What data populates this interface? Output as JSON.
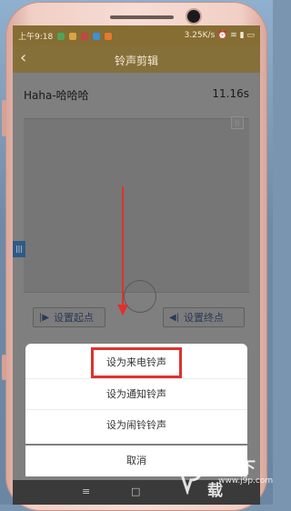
{
  "status_bar": {
    "time": "上午9:18",
    "network_speed": "3.25K/s",
    "icons": [
      "wechat-icon",
      "app-icon",
      "app-icon",
      "app-icon",
      "app-icon",
      "app-icon",
      "app-icon",
      "alarm-icon",
      "wifi-icon",
      "signal-icon",
      "battery-icon"
    ]
  },
  "header": {
    "back_icon": "back-arrow-icon",
    "title": "铃声剪辑"
  },
  "track": {
    "name": "Haha-哈哈哈",
    "duration": "11.16s"
  },
  "controls": {
    "set_start": "设置起点",
    "set_end": "设置终点"
  },
  "sheet": {
    "options": [
      "设为来电铃声",
      "设为通知铃声",
      "设为闹铃铃声"
    ],
    "cancel": "取消",
    "highlighted": "设为来电铃声"
  },
  "nav_bar": {
    "menu": "≡",
    "home": "□",
    "back": "‹"
  },
  "watermark": {
    "name": "精品下载",
    "url": "www.j9p.com"
  },
  "colors": {
    "annotation": "#e0312d",
    "header_bg": "#86703a"
  }
}
